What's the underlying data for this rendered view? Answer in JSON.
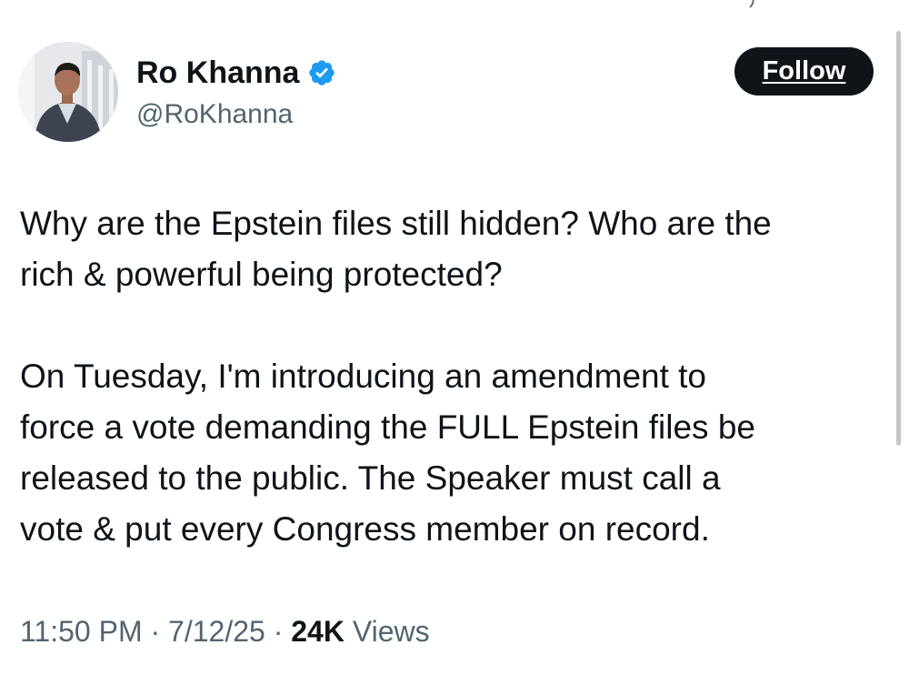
{
  "author": {
    "display_name": "Ro Khanna",
    "handle": "@RoKhanna",
    "verified_icon": "verified-badge-icon",
    "avatar": "profile-photo"
  },
  "follow_button": {
    "label": "Follow"
  },
  "tweet": {
    "paragraph_1": "Why are the Epstein files still hidden? Who are the\nrich & powerful being protected?",
    "paragraph_2": "On Tuesday, I'm introducing an amendment to\nforce a vote demanding the FULL Epstein files be\nreleased to the public. The Speaker must call a\nvote & put every Congress member on record."
  },
  "meta": {
    "time": "11:50 PM",
    "separator": "·",
    "date": "7/12/25",
    "views_count": "24K",
    "views_label": "Views"
  },
  "colors": {
    "primary_text": "#0f1419",
    "secondary_text": "#536471",
    "verified_blue": "#1d9bf0",
    "button_bg": "#0f1419",
    "button_text": "#ffffff"
  }
}
